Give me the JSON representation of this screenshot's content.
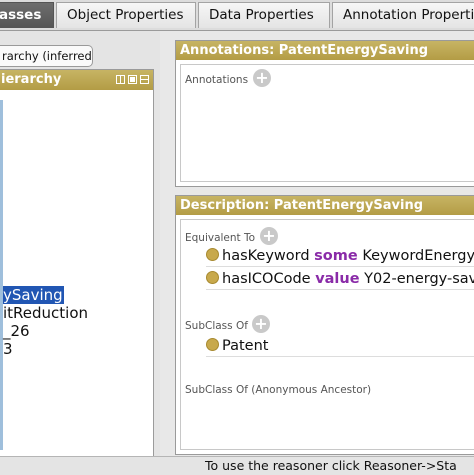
{
  "tabs": [
    {
      "label": "asses",
      "active": true
    },
    {
      "label": "Object Properties",
      "active": false
    },
    {
      "label": "Data Properties",
      "active": false
    },
    {
      "label": "Annotation Properti",
      "active": false
    }
  ],
  "left_panel": {
    "subtab_label": "rarchy (inferred)",
    "header_label": "ierarchy",
    "header_buttons": [
      "add-subclass-icon",
      "add-sibling-icon",
      "delete-class-icon"
    ],
    "tree_items": [
      {
        "label": "ySaving",
        "selected": true
      },
      {
        "label": "itReduction",
        "selected": false
      },
      {
        "label": "_26",
        "selected": false
      },
      {
        "label": "3",
        "selected": false
      }
    ]
  },
  "annotations_panel": {
    "header": "Annotations: PatentEnergySaving",
    "section_label": "Annotations",
    "add_icon": "+"
  },
  "description_panel": {
    "header": "Description: PatentEnergySaving",
    "equivalent_label": "Equivalent To",
    "equivalent_axioms": [
      {
        "prop": "hasKeyword",
        "kw": "some",
        "filler": "KeywordEnergyS"
      },
      {
        "prop": "hasICOCode",
        "kw": "value",
        "filler": "Y02-energy-sav"
      }
    ],
    "subclass_label": "SubClass Of",
    "subclass_axioms": [
      {
        "class": "Patent"
      }
    ],
    "anon_label": "SubClass Of (Anonymous Ancestor)",
    "add_icon": "+"
  },
  "status_bar": {
    "text": "To use the reasoner click Reasoner->Sta"
  },
  "colors": {
    "header_gold": "#b8a14e",
    "keyword_purple": "#8a2ba8",
    "selection_blue": "#2156b3",
    "bullet_gold": "#c8a94c"
  }
}
